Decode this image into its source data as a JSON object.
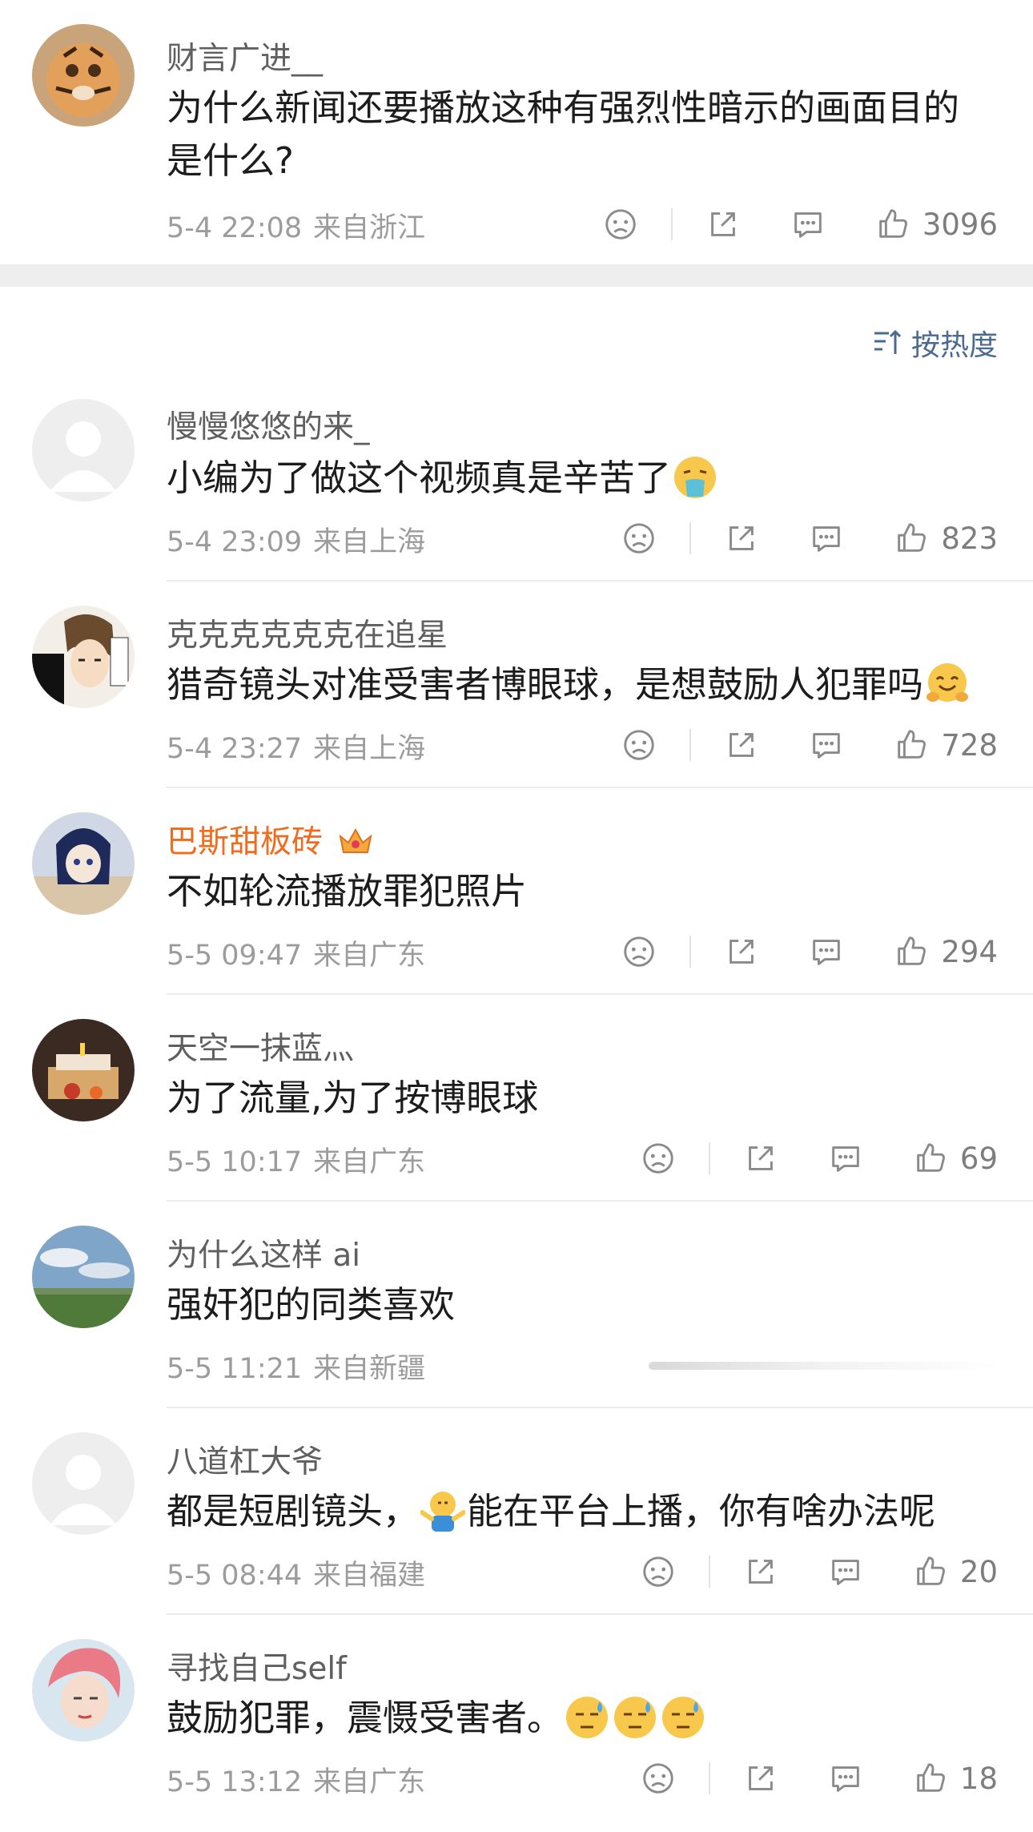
{
  "sort": {
    "label": "按热度",
    "icon": "sort-icon"
  },
  "comments": [
    {
      "username": "财言广进__",
      "text": "为什么新闻还要播放这种有强烈性暗示的画面目的是什么?",
      "time": "5-4 22:08",
      "location": "来自浙江",
      "likes": "3096",
      "avatar": "tiger-avatar"
    },
    {
      "username": "慢慢悠悠的来_",
      "text": "小编为了做这个视频真是辛苦了",
      "emoji": [
        "vomit-emoji"
      ],
      "time": "5-4 23:09",
      "location": "来自上海",
      "likes": "823",
      "avatar": "default-avatar"
    },
    {
      "username": "克克克克克克在追星",
      "text": "猎奇镜头对准受害者博眼球，是想鼓励人犯罪吗",
      "emoji": [
        "hug-emoji"
      ],
      "time": "5-4 23:27",
      "location": "来自上海",
      "likes": "728",
      "avatar": "anime-avatar"
    },
    {
      "username": "巴斯甜板砖",
      "username_badge": "crown-badge-icon",
      "text": "不如轮流播放罪犯照片",
      "time": "5-5 09:47",
      "location": "来自广东",
      "likes": "294",
      "avatar": "doll-avatar"
    },
    {
      "username": "天空一抹蓝灬",
      "text": "为了流量,为了按博眼球",
      "time": "5-5 10:17",
      "location": "来自广东",
      "likes": "69",
      "avatar": "cake-avatar"
    },
    {
      "username": "为什么这样 ai",
      "text": "强奸犯的同类喜欢",
      "time": "5-5 11:21",
      "location": "来自新疆",
      "likes": "",
      "avatar": "sky-avatar"
    },
    {
      "username": "八道杠大爷",
      "text_before": "都是短剧镜头，",
      "text_after": "能在平台上播，你有啥办法呢",
      "emoji": [
        "shrug-emoji"
      ],
      "time": "5-5 08:44",
      "location": "来自福建",
      "likes": "20",
      "avatar": "default-avatar"
    },
    {
      "username": "寻找自己self",
      "text": "鼓励犯罪，震慑受害者。",
      "emoji": [
        "sweat-emoji",
        "sweat-emoji",
        "sweat-emoji"
      ],
      "time": "5-5 13:12",
      "location": "来自广东",
      "likes": "18",
      "avatar": "pink-hair-avatar"
    }
  ],
  "colors": {
    "accent_orange": "#f26a1b",
    "link_blue": "#4b6a92",
    "meta_gray": "#9c9c9c"
  }
}
